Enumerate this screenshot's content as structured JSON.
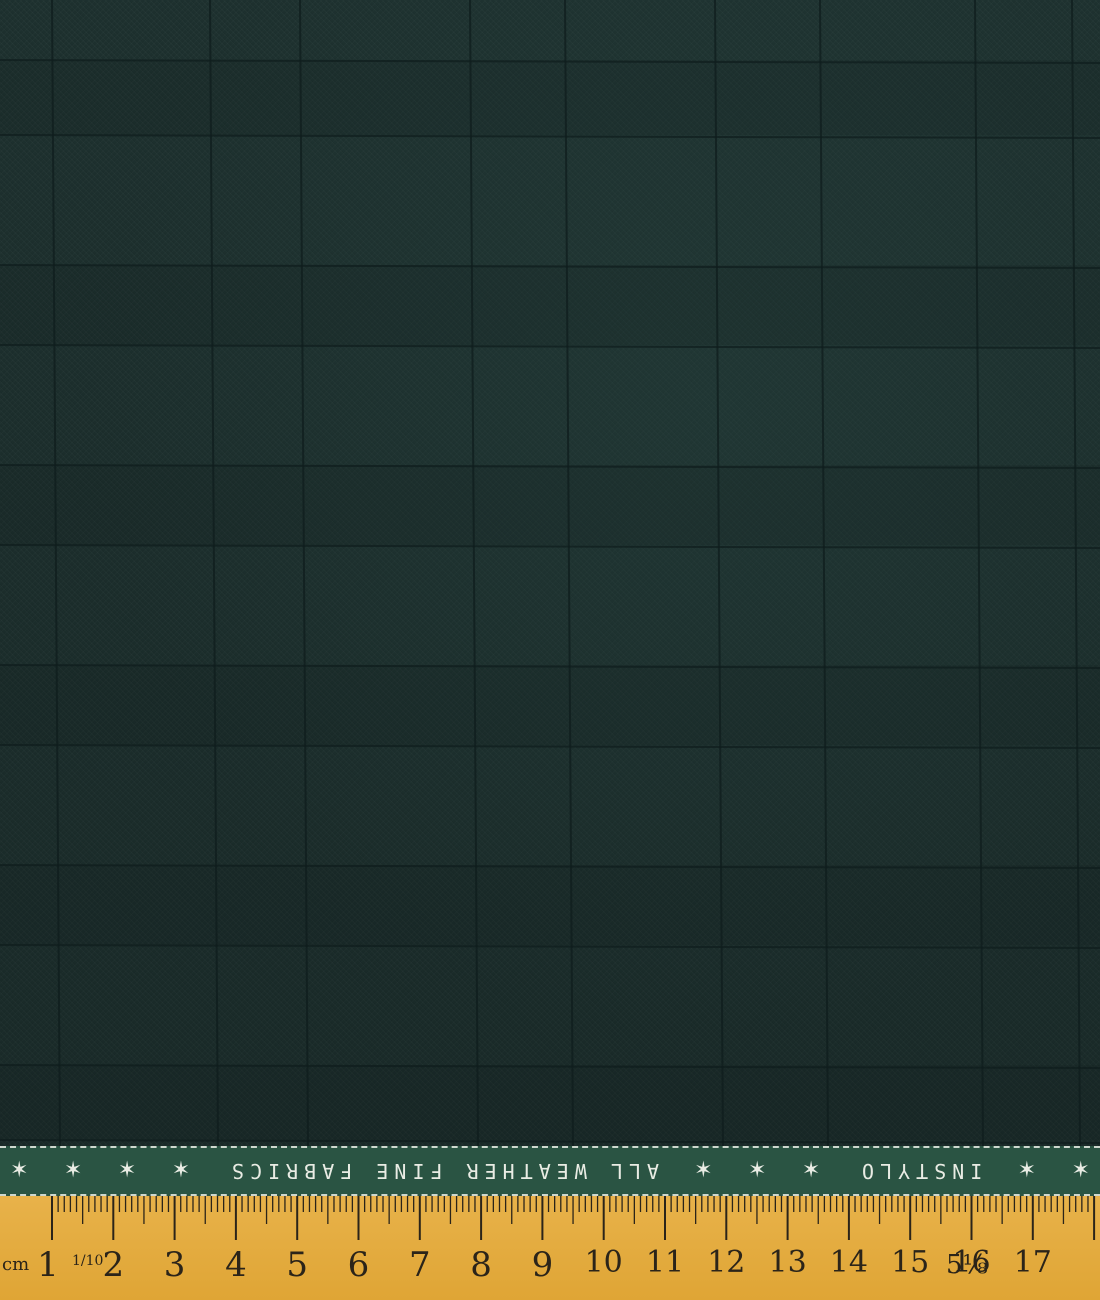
{
  "fabric": {
    "base_color": "#1f3331",
    "check_line_color": "#0f1d1d",
    "pattern": "windowpane-check"
  },
  "selvedge": {
    "background_color": "#2a5443",
    "text_color": "#e9ece4",
    "text": "ALL WEATHER FINE FABRICS",
    "brand": "INSTYLO",
    "star_icon": "star-icon"
  },
  "ruler": {
    "color": "#e3a93c",
    "unit_label": "cm",
    "fraction_label": "1/10",
    "fraction_marker": "5⅛",
    "numbers": [
      "1",
      "2",
      "3",
      "4",
      "5",
      "6",
      "7",
      "8",
      "9",
      "10",
      "11",
      "12",
      "13",
      "14",
      "15",
      "16",
      "17"
    ]
  }
}
